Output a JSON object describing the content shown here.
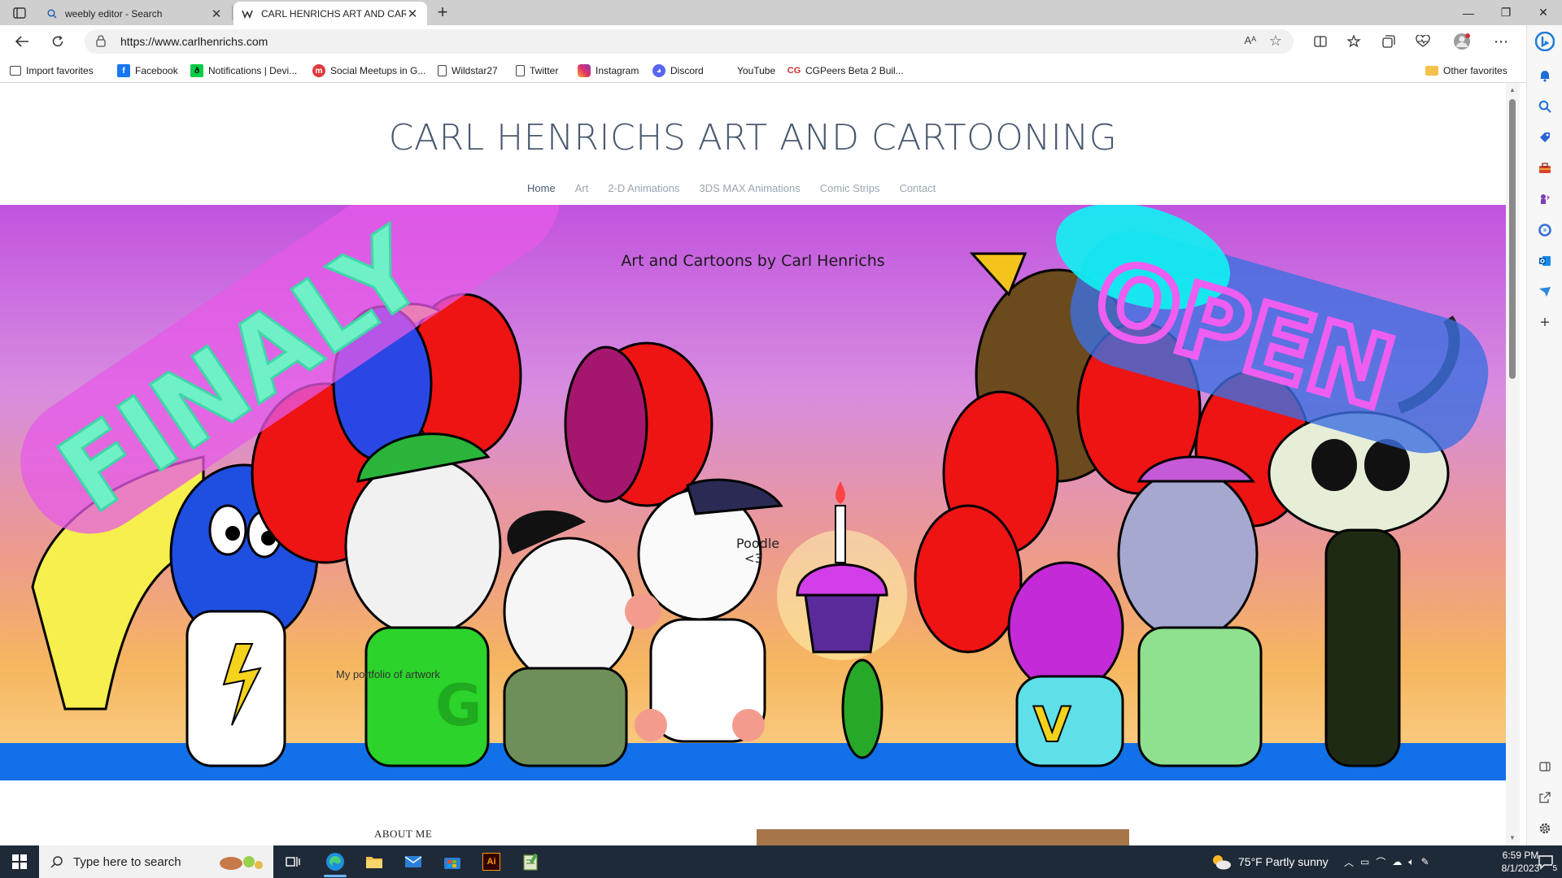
{
  "browser": {
    "tabs": [
      {
        "title": "weebly editor - Search",
        "icon": "search-icon"
      },
      {
        "title": "CARL HENRICHS ART AND CARTOONING",
        "icon": "weebly-w-icon"
      }
    ],
    "url": "https://www.carlhenrichs.com",
    "read_aloud": "Aᴬ",
    "favorites": [
      {
        "label": "Import favorites",
        "icon": "import-icon"
      },
      {
        "label": "Facebook",
        "icon": "facebook-icon"
      },
      {
        "label": "Notifications | Devi...",
        "icon": "deviantart-icon"
      },
      {
        "label": "Social Meetups in G...",
        "icon": "meetup-icon"
      },
      {
        "label": "Wildstar27",
        "icon": "page-icon"
      },
      {
        "label": "Twitter",
        "icon": "page-icon"
      },
      {
        "label": "Instagram",
        "icon": "instagram-icon"
      },
      {
        "label": "Discord",
        "icon": "discord-icon"
      },
      {
        "label": "YouTube",
        "icon": "youtube-icon"
      },
      {
        "label": "CGPeers Beta 2 Buil...",
        "icon": "cg-icon"
      }
    ],
    "other_favorites": "Other favorites"
  },
  "site": {
    "title": "CARL HENRICHS ART AND CARTOONING",
    "nav": [
      "Home",
      "Art",
      "2-D Animations",
      "3DS MAX Animations",
      "Comic Strips",
      "Contact"
    ],
    "hero_caption": "Art and Cartoons by Carl Henrichs",
    "hero_left_sign": "FINALY",
    "hero_right_sign": "OPEN",
    "hero_sub": "My portfolio of artwork",
    "poodle_cap": "Poodle",
    "poodle_cap2": "<3",
    "shirt_letter_g": "G",
    "shirt_letter_v": "V",
    "about_heading": "ABOUT ME"
  },
  "taskbar": {
    "search_placeholder": "Type here to search",
    "weather": "75°F  Partly sunny",
    "time": "6:59 PM",
    "date": "8/1/2023",
    "notification_count": "5",
    "ai_label": "Ai"
  },
  "colors": {
    "accent": "#0078d4",
    "hero_ocean": "#1270e8",
    "sign_left": "#5df0c3",
    "sign_right": "#e54de8"
  }
}
